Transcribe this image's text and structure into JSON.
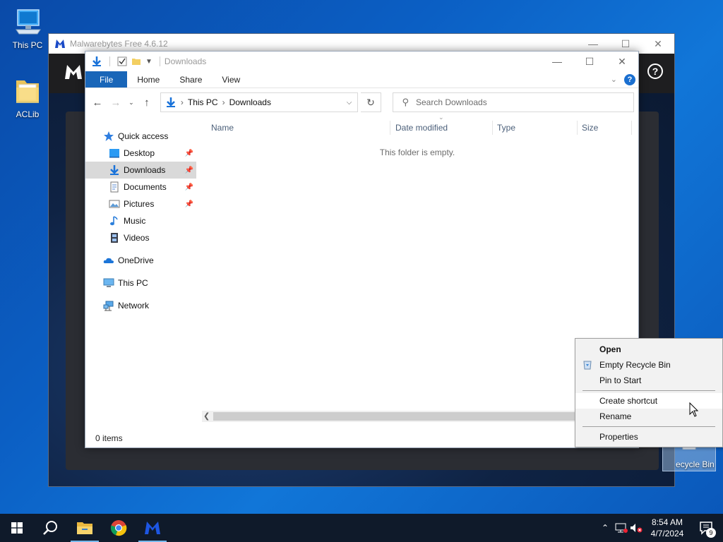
{
  "desktop": {
    "icons": [
      {
        "label": "This PC"
      },
      {
        "label": "ACLib"
      },
      {
        "label": "Recycle Bin",
        "visible_label": "ecycle Bin"
      }
    ]
  },
  "malwarebytes": {
    "title": "Malwarebytes Free 4.6.12",
    "help_label": "?"
  },
  "explorer": {
    "title": "Downloads",
    "ribbon_tabs": [
      "File",
      "Home",
      "Share",
      "View"
    ],
    "help_label": "?",
    "address": {
      "path": [
        "This PC",
        "Downloads"
      ]
    },
    "search": {
      "placeholder": "Search Downloads"
    },
    "nav": {
      "quick_access": "Quick access",
      "pinned": [
        "Desktop",
        "Downloads",
        "Documents",
        "Pictures"
      ],
      "other": [
        "Music",
        "Videos"
      ],
      "onedrive": "OneDrive",
      "this_pc": "This PC",
      "network": "Network"
    },
    "columns": [
      "Name",
      "Date modified",
      "Type",
      "Size"
    ],
    "empty_message": "This folder is empty.",
    "status": "0 items"
  },
  "context_menu": {
    "items": [
      "Open",
      "Empty Recycle Bin",
      "Pin to Start",
      "Create shortcut",
      "Rename",
      "Properties"
    ]
  },
  "taskbar": {
    "time": "8:54 AM",
    "date": "4/7/2024",
    "notification_count": "9"
  },
  "colors": {
    "accent": "#1966b8",
    "selection": "#cce8ff",
    "taskbar": "#0f1a2a"
  }
}
